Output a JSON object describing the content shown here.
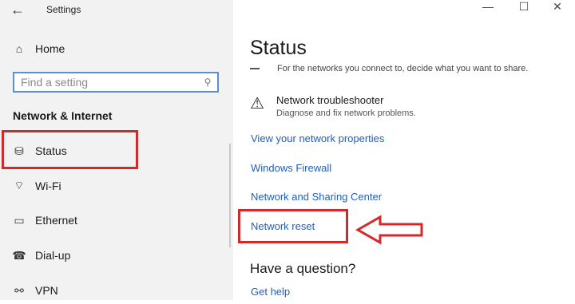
{
  "window": {
    "title": "Settings",
    "back_icon": "←",
    "minimize_icon": "—",
    "maximize_icon": "☐",
    "close_icon": "✕"
  },
  "sidebar": {
    "home": {
      "label": "Home",
      "icon": "⌂"
    },
    "search": {
      "placeholder": "Find a setting",
      "icon": "⚲"
    },
    "section_title": "Network & Internet",
    "items": [
      {
        "label": "Status",
        "icon": "⛁",
        "highlighted": true
      },
      {
        "label": "Wi-Fi",
        "icon": "⌔"
      },
      {
        "label": "Ethernet",
        "icon": "▭"
      },
      {
        "label": "Dial-up",
        "icon": "☎"
      },
      {
        "label": "VPN",
        "icon": "⚯"
      }
    ]
  },
  "main": {
    "title": "Status",
    "cut_text": "For the networks you connect to, decide what you want to share.",
    "troubleshooter": {
      "icon": "⚠",
      "title": "Network troubleshooter",
      "subtitle": "Diagnose and fix network problems."
    },
    "links": [
      "View your network properties",
      "Windows Firewall",
      "Network and Sharing Center",
      "Network reset"
    ],
    "question_heading": "Have a question?",
    "get_help": "Get help"
  },
  "colors": {
    "accent_link": "#1f5fbf",
    "highlight_red": "#d22a2a",
    "search_border": "#5a8ed6"
  }
}
